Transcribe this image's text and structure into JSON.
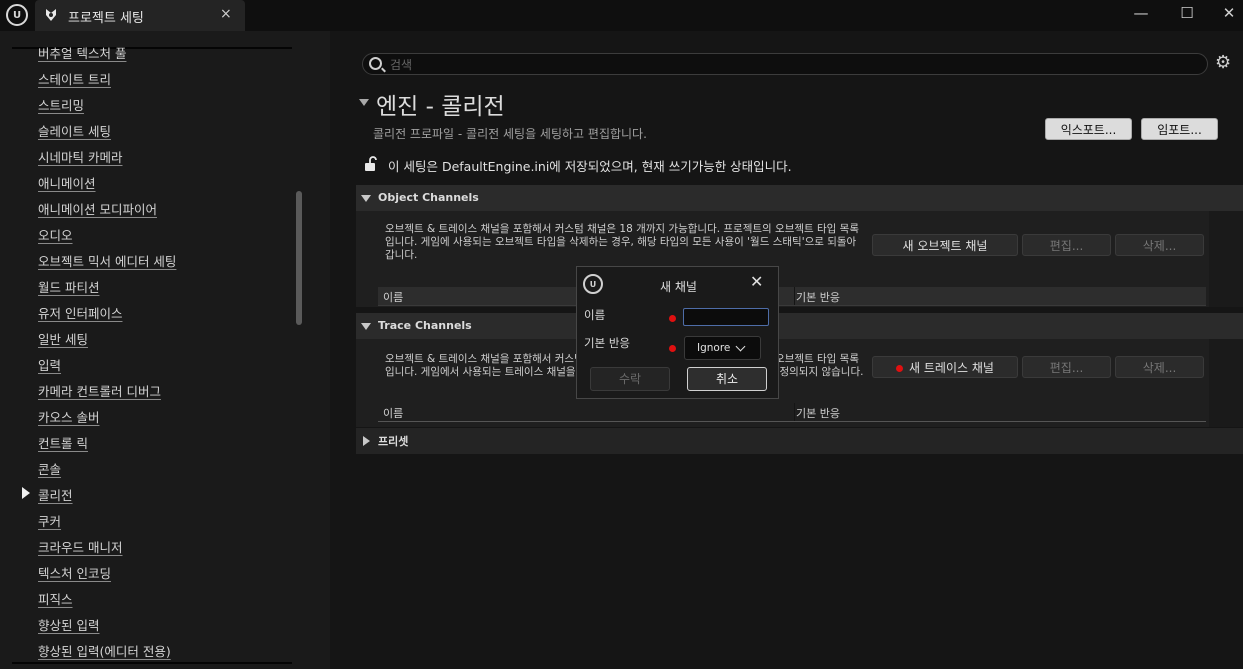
{
  "window": {
    "tab_title": "프로젝트 세팅",
    "close_glyph": "×",
    "minimize_glyph": "—",
    "maximize_glyph": "☐",
    "window_close_glyph": "✕"
  },
  "sidebar": {
    "items": [
      "버추얼 텍스처 풀",
      "스테이트 트리",
      "스트리밍",
      "슬레이트 세팅",
      "시네마틱 카메라",
      "애니메이션",
      "애니메이션 모디파이어",
      "오디오",
      "오브젝트 믹서 에디터 세팅",
      "월드 파티션",
      "유저 인터페이스",
      "일반 세팅",
      "입력",
      "카메라 컨트롤러 디버그",
      "카오스 솔버",
      "컨트롤 릭",
      "콘솔",
      "콜리전",
      "쿠커",
      "크라우드 매니저",
      "텍스처 인코딩",
      "피직스",
      "향상된 입력",
      "향상된 입력(에디터 전용)"
    ],
    "selected_index": 17
  },
  "search": {
    "placeholder": "검색"
  },
  "header": {
    "title": "엔진 - 콜리전",
    "subtitle": "콜리전 프로파일 - 콜리전 세팅을 세팅하고 편집합니다.",
    "export_label": "익스포트...",
    "import_label": "임포트...",
    "config_info": "이 세팅은 DefaultEngine.ini에 저장되었으며, 현재 쓰기가능한 상태입니다."
  },
  "object_channels": {
    "title": "Object Channels",
    "description": "오브젝트 & 트레이스 채널을 포함해서 커스텀 채널은 18 개까지 가능합니다. 프로젝트의 오브젝트 타입 목록입니다. 게임에 사용되는 오브젝트 타입을 삭제하는 경우, 해당 타입의 모든 사용이 '월드 스태틱'으로 되돌아갑니다.",
    "new_label": "새 오브젝트 채널",
    "edit_label": "편집...",
    "delete_label": "삭제...",
    "col_name": "이름",
    "col_response": "기본 반응"
  },
  "trace_channels": {
    "title": "Trace Channels",
    "description": "오브젝트 & 트레이스 채널을 포함해서 커스텀 채널은 18 개까지 가능합니다. 프로젝트의 오브젝트 타입 목록입니다. 게임에서 사용되는 트레이스 채널을 삭제하는 경우, 해당 채널은 무시되며 더 이상 정의되지 않습니다.",
    "new_label": "새 트레이스 채널",
    "edit_label": "편집...",
    "delete_label": "삭제...",
    "col_name": "이름",
    "col_response": "기본 반응"
  },
  "presets": {
    "title": "프리셋"
  },
  "dialog": {
    "title": "새 채널",
    "name_label": "이름",
    "name_value": "",
    "response_label": "기본 반응",
    "response_value": "Ignore",
    "accept_label": "수락",
    "cancel_label": "취소"
  },
  "colors": {
    "required_dot": "#e01010",
    "focus_border": "#4e6da8"
  }
}
